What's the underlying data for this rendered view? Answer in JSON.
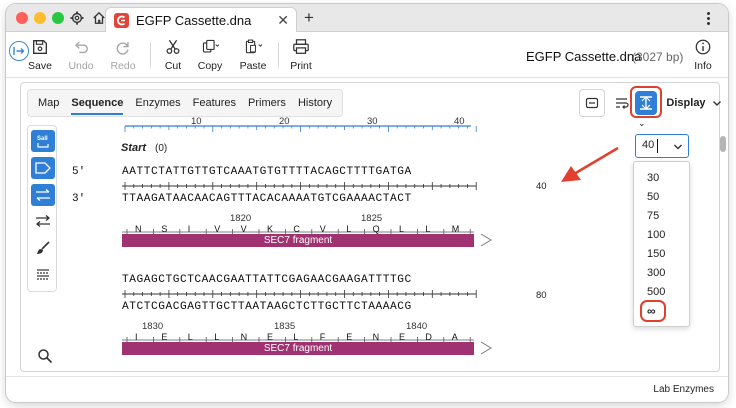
{
  "titlebar": {
    "tab_title": "EGFP Cassette.dna",
    "close_glyph": "✕",
    "new_tab_glyph": "+"
  },
  "toolbar": {
    "save_label": "Save",
    "undo_label": "Undo",
    "redo_label": "Redo",
    "cut_label": "Cut",
    "copy_label": "Copy",
    "paste_label": "Paste",
    "print_label": "Print",
    "info_label": "Info",
    "file_name": "EGFP Cassette.dna",
    "file_size": "(3027 bp)"
  },
  "view_tabs": [
    {
      "label": "Map",
      "active": false
    },
    {
      "label": "Sequence",
      "active": true
    },
    {
      "label": "Enzymes",
      "active": false
    },
    {
      "label": "Features",
      "active": false
    },
    {
      "label": "Primers",
      "active": false
    },
    {
      "label": "History",
      "active": false
    }
  ],
  "display_button": {
    "label": "Display"
  },
  "ruler": {
    "ticks": [
      "10",
      "20",
      "30",
      "40"
    ]
  },
  "sequence": {
    "start_label": "Start",
    "start_value": "(0)",
    "prime5": "5'",
    "prime3": "3'",
    "row1": {
      "top": "AATTCTATTGTTGTCAAATGTGTTTTACAGCTTTTGATGA",
      "bottom": "TTAAGATAACAACAGTTTACACAAAATGTCGAAAACTACT",
      "coords": [
        "1820",
        "1825"
      ],
      "aa": [
        "N",
        "S",
        "I",
        "V",
        "V",
        "K",
        "C",
        "V",
        "L",
        "Q",
        "L",
        "L",
        "M"
      ],
      "feature": "SEC7 fragment",
      "line_number": "40"
    },
    "row2": {
      "top": "TAGAGCTGCTCAACGAATTATTCGAGAACGAAGATTTTGC",
      "bottom": "ATCTCGACGAGTTGCTTAATAAGCTCTTGCTTCTAAAACG",
      "coords": [
        "1830",
        "1835",
        "1840"
      ],
      "aa": [
        "I",
        "E",
        "L",
        "L",
        "N",
        "E",
        "L",
        "F",
        "E",
        "N",
        "E",
        "D",
        "A"
      ],
      "feature": "SEC7 fragment",
      "line_number": "80"
    }
  },
  "line_length_select": {
    "value": "40",
    "options": [
      "30",
      "50",
      "75",
      "100",
      "150",
      "300",
      "500",
      "∞"
    ]
  },
  "status": {
    "right_text": "Lab Enzymes"
  },
  "colors": {
    "accent": "#2f7fd6",
    "highlight": "#e1402f",
    "feature": "#a03272"
  }
}
